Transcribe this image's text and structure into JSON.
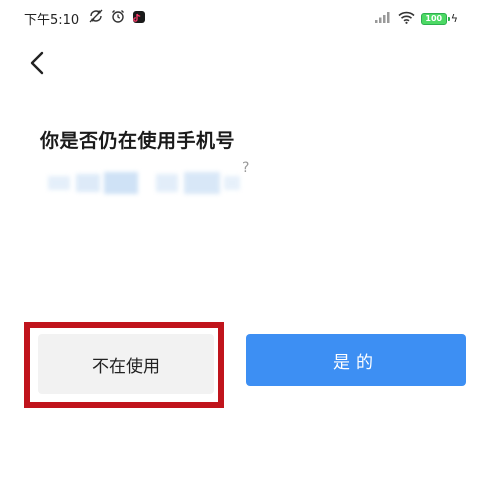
{
  "status_bar": {
    "time": "下午5:10",
    "battery_level": "100",
    "icons": [
      "sync-off-icon",
      "alarm-icon",
      "app-notification-icon",
      "signal-icon",
      "wifi-icon",
      "battery-icon",
      "charging-icon"
    ]
  },
  "question": {
    "title": "你是否仍在使用手机号",
    "number_suffix": "?"
  },
  "buttons": {
    "decline_label": "不在使用",
    "confirm_label": "是的"
  },
  "colors": {
    "confirm_button": "#3d8ff3",
    "decline_button": "#f2f2f2",
    "highlight_frame": "#c0141c",
    "battery": "#4cd964"
  }
}
